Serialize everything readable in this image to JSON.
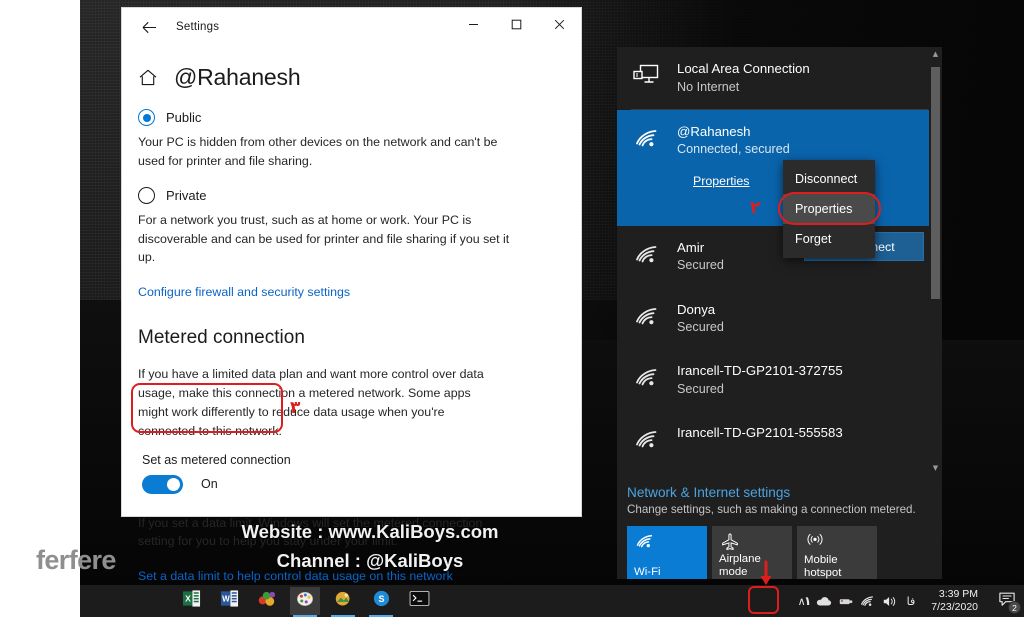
{
  "window": {
    "title": "Settings",
    "back_icon": "back-arrow-icon",
    "minimize": "─",
    "maximize": "☐",
    "close": "✕",
    "home_icon": "home-icon",
    "page_title": "@Rahanesh"
  },
  "network_profile": {
    "public": {
      "label": "Public",
      "selected": true,
      "description": "Your PC is hidden from other devices on the network and can't be used for printer and file sharing."
    },
    "private": {
      "label": "Private",
      "selected": false,
      "description": "For a network you trust, such as at home or work. Your PC is discoverable and can be used for printer and file sharing if you set it up."
    },
    "firewall_link": "Configure firewall and security settings"
  },
  "metered": {
    "section_title": "Metered connection",
    "description": "If you have a limited data plan and want more control over data usage, make this connection a metered network. Some apps might work differently to reduce data usage when you're connected to this network.",
    "toggle_label": "Set as metered connection",
    "toggle_state": "On",
    "toggle_on": true,
    "note": "If you set a data limit, Windows will set the metered connection setting for you to help you stay under your limit.",
    "data_limit_link": "Set a data limit to help control data usage on this network",
    "annotation": "۳"
  },
  "watermark": {
    "website": "Website : www.KaliBoys.com",
    "channel": "Channel : @KaliBoys",
    "logo": "ferfere"
  },
  "flyout": {
    "networks": [
      {
        "name": "Local Area Connection",
        "status": "No Internet",
        "icon": "ethernet-icon",
        "selected": false
      },
      {
        "name": "@Rahanesh",
        "status": "Connected, secured",
        "icon": "wifi-icon",
        "selected": true,
        "properties_link": "Properties",
        "disconnect_button": "Disconnect",
        "annotation": "۲"
      },
      {
        "name": "Amir",
        "status": "Secured",
        "icon": "wifi-icon",
        "selected": false
      },
      {
        "name": "Donya",
        "status": "Secured",
        "icon": "wifi-icon",
        "selected": false
      },
      {
        "name": "Irancell-TD-GP2101-372755",
        "status": "Secured",
        "icon": "wifi-icon",
        "selected": false
      },
      {
        "name": "Irancell-TD-GP2101-555583",
        "status": "",
        "icon": "wifi-icon",
        "selected": false
      }
    ],
    "context_menu": [
      {
        "label": "Disconnect",
        "hovered": false
      },
      {
        "label": "Properties",
        "hovered": true
      },
      {
        "label": "Forget",
        "hovered": false
      }
    ],
    "settings_title": "Network & Internet settings",
    "settings_sub": "Change settings, such as making a connection metered.",
    "tiles": [
      {
        "label": "Wi-Fi",
        "icon": "wifi-icon",
        "active": true
      },
      {
        "label": "Airplane mode",
        "icon": "airplane-icon",
        "active": false
      },
      {
        "label": "Mobile hotspot",
        "icon": "hotspot-icon",
        "active": false
      }
    ],
    "scroll_up": "▲",
    "scroll_down": "▼"
  },
  "taskbar": {
    "apps": [
      {
        "name": "excel-app",
        "icon": "excel-icon"
      },
      {
        "name": "word-app",
        "icon": "word-icon"
      },
      {
        "name": "media-app",
        "icon": "media-icon"
      },
      {
        "name": "paint-app",
        "icon": "paint-icon"
      },
      {
        "name": "photo-app",
        "icon": "photo-icon"
      },
      {
        "name": "skype-app",
        "icon": "skype-icon"
      },
      {
        "name": "terminal-app",
        "icon": "terminal-icon"
      }
    ],
    "tray": {
      "chevron": "∧",
      "cloud_icon": "onedrive-cloud-icon",
      "usb_icon": "removable-device-icon",
      "wifi_icon": "wifi-tray-icon",
      "speaker_icon": "speaker-icon",
      "keyboard_lang": "فا",
      "time": "3:39 PM",
      "date": "7/23/2020",
      "notifications_icon": "action-center-icon",
      "notification_count": "2",
      "annotation": "۱"
    }
  },
  "colors": {
    "accent": "#0078d4",
    "annotation_red": "#e01d1d",
    "selected_blue": "#0a64ac",
    "link_blue": "#0a64c8"
  }
}
